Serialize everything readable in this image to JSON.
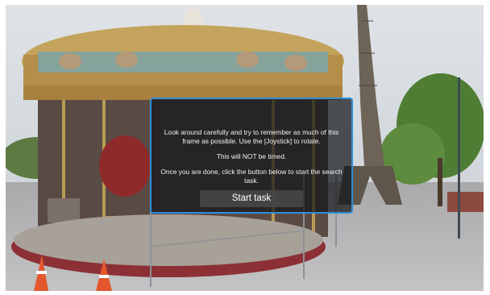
{
  "dialog": {
    "instruction": "Look around carefully and try to remember as much of this frame as possible. Use the [Joystick] to rotate.",
    "timing_note": "This will NOT be timed.",
    "next_step": "Once you are done, click the button below to start the search task.",
    "start_button_label": "Start task"
  },
  "colors": {
    "dialog_border": "#2e8fd8",
    "dialog_background": "#14161a",
    "button_background": "#464646"
  }
}
